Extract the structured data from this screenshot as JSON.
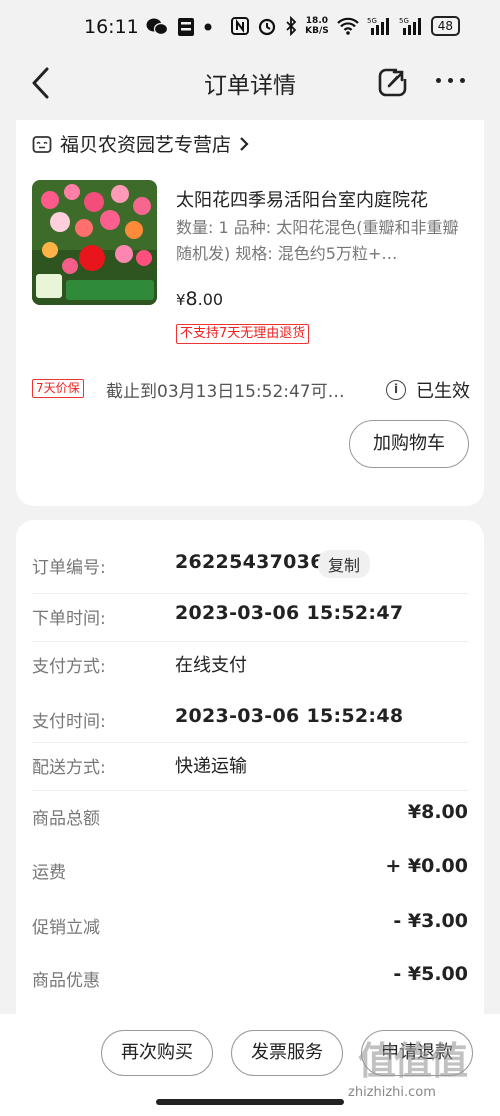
{
  "status_bar": {
    "time": "16:11",
    "speed_top": "18.0",
    "speed_bottom": "KB/S",
    "signal1": "5G",
    "signal2": "5G",
    "battery": "48"
  },
  "nav": {
    "title": "订单详情",
    "back_icon": "chevron-left-icon",
    "share_icon": "share-icon",
    "more_icon": "more-horizontal-icon"
  },
  "product_card": {
    "store_name": "福贝农资园艺专营店",
    "store_icon": "store-icon",
    "product_title": "太阳花四季易活阳台室内庭院花",
    "spec": "数量: 1  品种: 太阳花混色(重瓣和非重瓣随机发)  规格: 混色约5万粒+…",
    "price_symbol": "¥",
    "price_int": "8",
    "price_dec": ".00",
    "no_return_tag": "不支持7天无理由退货",
    "price_protect_tag": "7天价保",
    "price_protect_text": "截止到03月13日15:52:47可…",
    "status_text": "已生效",
    "add_cart_label": "加购物车"
  },
  "order_info": {
    "rows": [
      {
        "label": "订单编号:",
        "value": "262254370368"
      },
      {
        "label": "下单时间:",
        "value": "2023-03-06 15:52:47"
      },
      {
        "label": "支付方式:",
        "value": "在线支付"
      },
      {
        "label": "支付时间:",
        "value": "2023-03-06 15:52:48"
      },
      {
        "label": "配送方式:",
        "value": "快递运输"
      }
    ],
    "copy_label": "复制",
    "amounts": [
      {
        "label": "商品总额",
        "value": "¥8.00"
      },
      {
        "label": "运费",
        "value": "+ ¥0.00"
      },
      {
        "label": "促销立减",
        "value": "- ¥3.00"
      },
      {
        "label": "商品优惠",
        "value": "- ¥5.00"
      }
    ]
  },
  "bottom_bar": {
    "buy_again": "再次购买",
    "invoice": "发票服务",
    "refund": "申请退款"
  },
  "watermark": {
    "logo": "值值值",
    "url": "zhizhizhi.com"
  },
  "colors": {
    "accent_red": "#e22222",
    "background": "#f2f2f2"
  }
}
